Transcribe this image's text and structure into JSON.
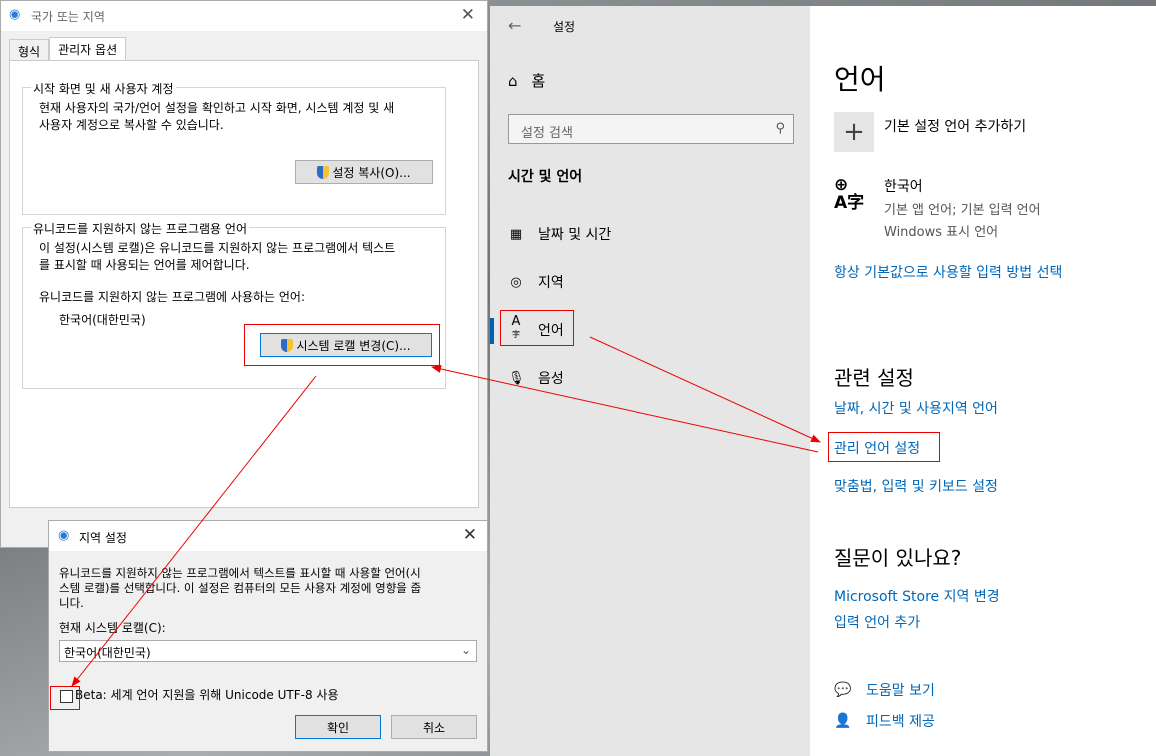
{
  "settings": {
    "window_title": "설정",
    "home_label": "홈",
    "search_placeholder": "설정 검색",
    "category": "시간 및 언어",
    "nav_items": [
      {
        "label": "날짜 및 시간",
        "icon": "calendar-clock-icon"
      },
      {
        "label": "지역",
        "icon": "globe-icon"
      },
      {
        "label": "언어",
        "icon": "language-icon"
      },
      {
        "label": "음성",
        "icon": "microphone-icon"
      }
    ],
    "page_title": "언어",
    "add_language_label": "기본 설정 언어 추가하기",
    "language": {
      "name": "한국어",
      "detail1": "기본 앱 언어; 기본 입력 언어",
      "detail2": "Windows 표시 언어"
    },
    "input_method_link": "항상 기본값으로 사용할 입력 방법 선택",
    "related_heading": "관련 설정",
    "related_links": [
      "날짜, 시간 및 사용지역 언어",
      "관리 언어 설정",
      "맞춤법, 입력 및 키보드 설정"
    ],
    "question_heading": "질문이 있나요?",
    "question_links": [
      "Microsoft Store 지역 변경",
      "입력 언어 추가"
    ],
    "help_label": "도움말 보기",
    "feedback_label": "피드백 제공"
  },
  "region_dialog": {
    "title": "국가 또는 지역",
    "tabs": [
      "형식",
      "관리자 옵션"
    ],
    "welcome_group_title": "시작 화면 및 새 사용자 계정",
    "welcome_text_1": "현재 사용자의 국가/언어 설정을 확인하고 시작 화면, 시스템 계정 및 새",
    "welcome_text_2": "사용자 계정으로 복사할 수 있습니다.",
    "copy_button": "설정 복사(O)...",
    "unicode_group_title": "유니코드를 지원하지 않는 프로그램용 언어",
    "unicode_text_1": "이 설정(시스템 로캘)은 유니코드를 지원하지 않는 프로그램에서 텍스트",
    "unicode_text_2": "를 표시할 때 사용되는 언어를 제어합니다.",
    "current_label": "유니코드를 지원하지 않는 프로그램에 사용하는 언어:",
    "current_value": "한국어(대한민국)",
    "change_locale_button": "시스템 로캘 변경(C)..."
  },
  "locale_dialog": {
    "title": "지역 설정",
    "desc_1": "유니코드를 지원하지 않는 프로그램에서 텍스트를 표시할 때 사용할 언어(시",
    "desc_2": "스템 로캘)를 선택합니다. 이 설정은 컴퓨터의 모든 사용자 계정에 영향을 줍",
    "desc_3": "니다.",
    "current_label": "현재 시스템 로캘(C):",
    "current_value": "한국어(대한민국)",
    "beta_label": "Beta: 세계 언어 지원을 위해 Unicode UTF-8 사용",
    "beta_checked": false,
    "ok_button": "확인",
    "cancel_button": "취소"
  },
  "colors": {
    "accent": "#0067b8",
    "annotation": "#e00000",
    "nav_bg": "#e6e6e6"
  }
}
